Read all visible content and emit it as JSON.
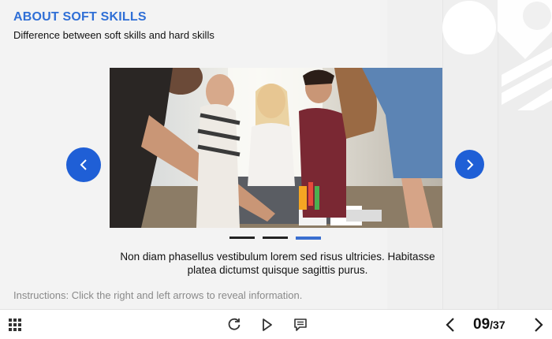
{
  "slide": {
    "title": "ABOUT SOFT SKILLS",
    "subtitle": "Difference between soft skills and hard skills",
    "caption": "Non diam phasellus vestibulum lorem sed risus ultricies. Habitasse platea dictumst quisque sagittis purus.",
    "instructions_label": "Instructions",
    "instructions_text": ": Click the right and left arrows to reveal information.",
    "image_alt": "people-collaborating-photo"
  },
  "carousel": {
    "total_dots": 3,
    "active_dot_index": 2,
    "prev_icon": "chevron-left-icon",
    "next_icon": "chevron-right-icon"
  },
  "toolbar": {
    "menu_icon": "grid-menu-icon",
    "replay_icon": "replay-icon",
    "play_icon": "play-icon",
    "notes_icon": "notes-icon",
    "prev_icon": "chevron-left-icon",
    "next_icon": "chevron-right-icon",
    "current_page": "09",
    "total_pages": "/37"
  },
  "colors": {
    "accent": "#2f6fd6",
    "nav_button": "#1f5fd6",
    "background": "#f3f3f3"
  }
}
